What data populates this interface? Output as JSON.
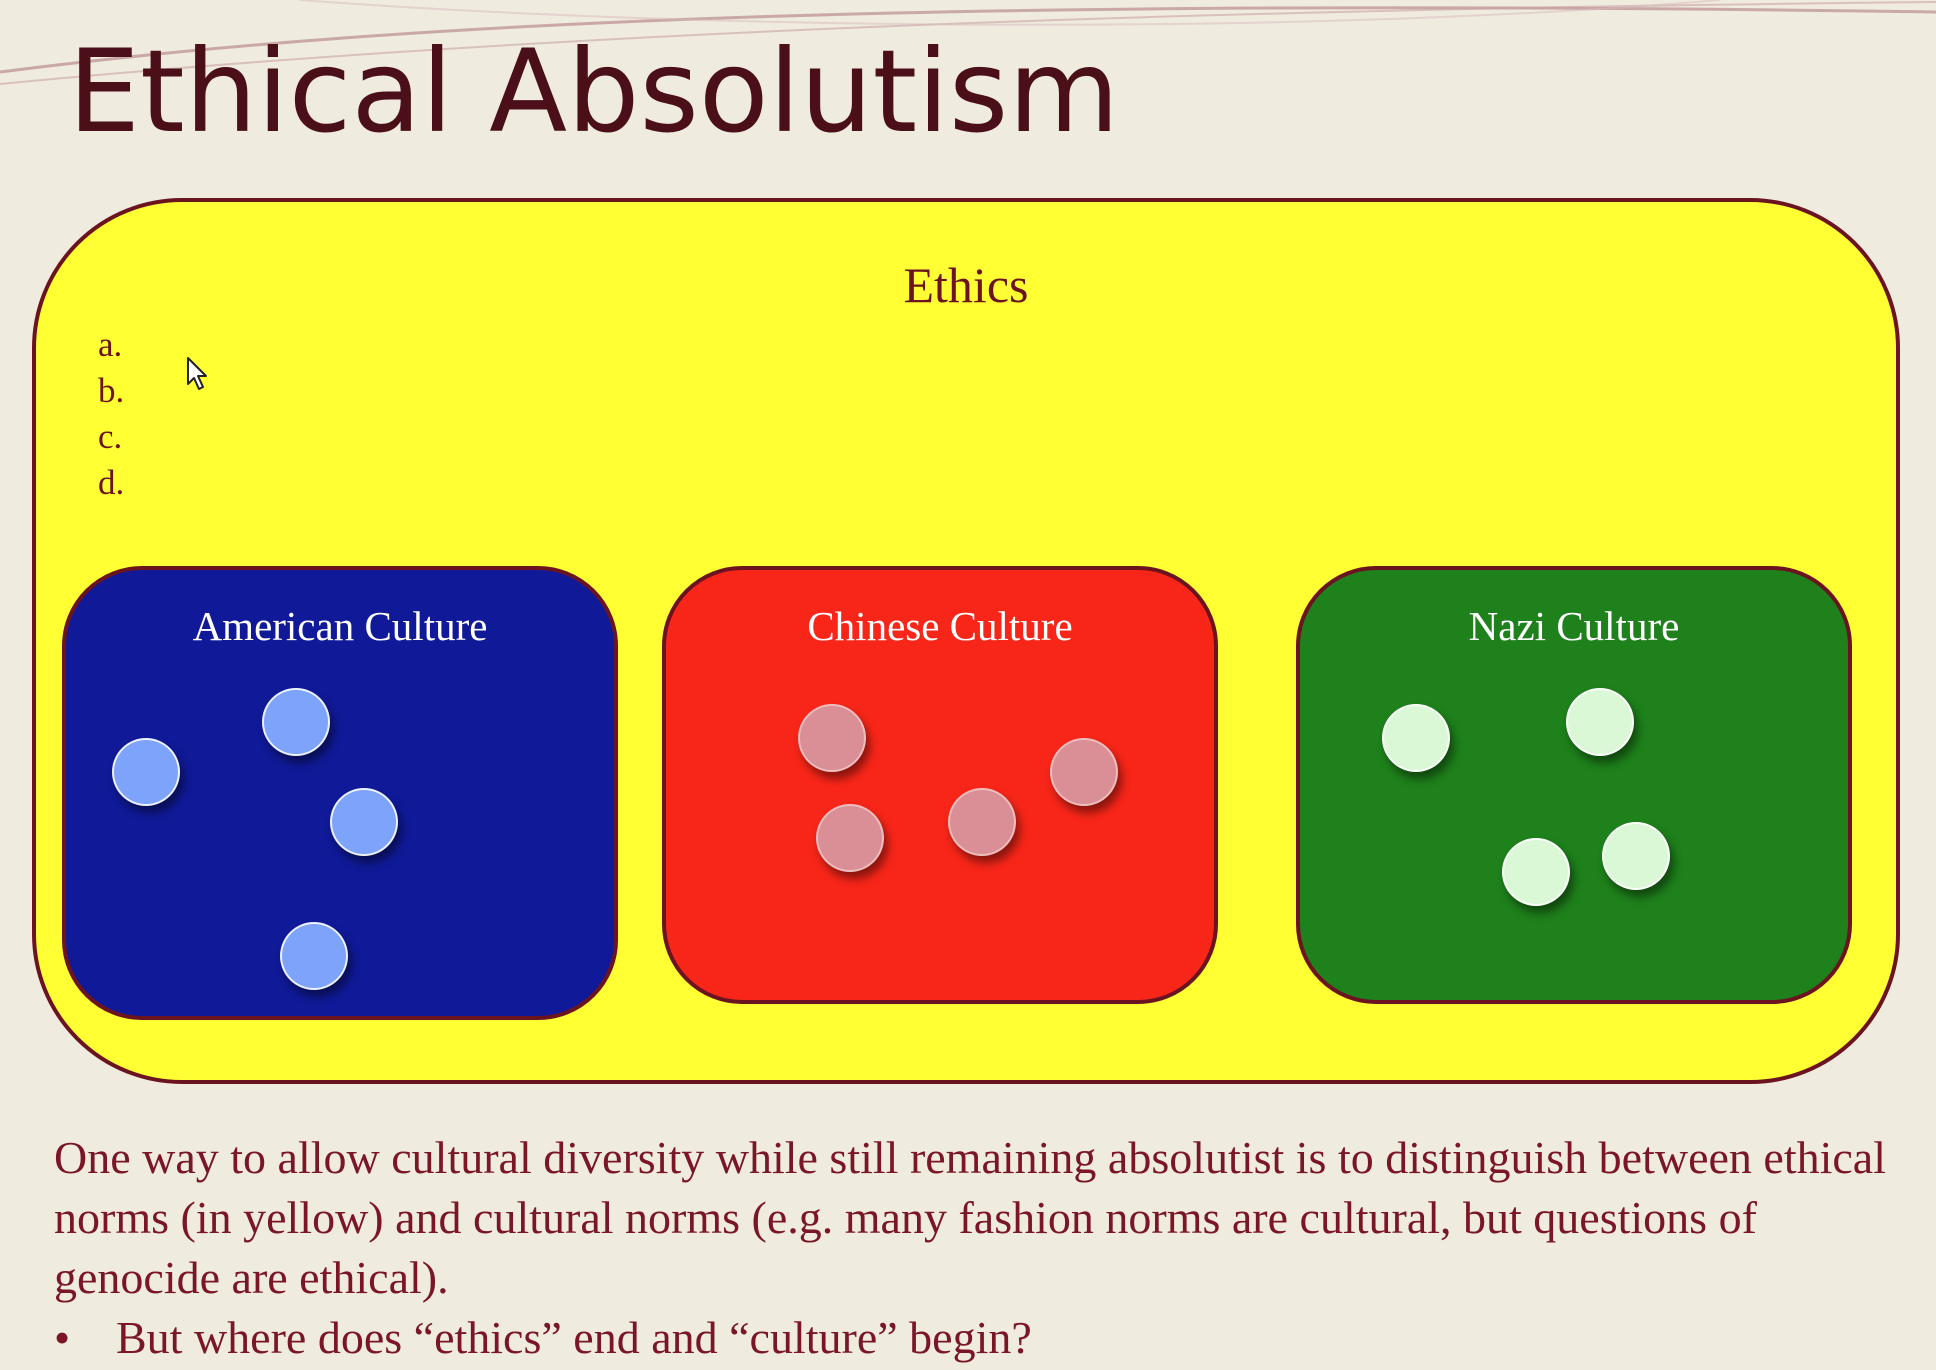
{
  "slide": {
    "title": "Ethical Absolutism"
  },
  "ethics": {
    "title": "Ethics",
    "items": [
      "a.",
      "b.",
      "c.",
      "d."
    ],
    "color": "#ffff33"
  },
  "cultures": [
    {
      "name": "American Culture",
      "color": "#101a98",
      "dot_color": "#7ea3fb"
    },
    {
      "name": "Chinese Culture",
      "color": "#f82619",
      "dot_color": "#d98f95"
    },
    {
      "name": "Nazi Culture",
      "color": "#1e811b",
      "dot_color": "#dbf8d6"
    }
  ],
  "caption": {
    "text": "One way to allow cultural diversity while still remaining absolutist is to distinguish between ethical norms (in yellow) and cultural norms (e.g. many fashion norms are cultural, but questions of genocide are ethical).",
    "bullet_symbol": "•",
    "bullet": "But where does “ethics” end and “culture” begin?"
  },
  "icons": {
    "cursor": "mouse-pointer-icon"
  }
}
